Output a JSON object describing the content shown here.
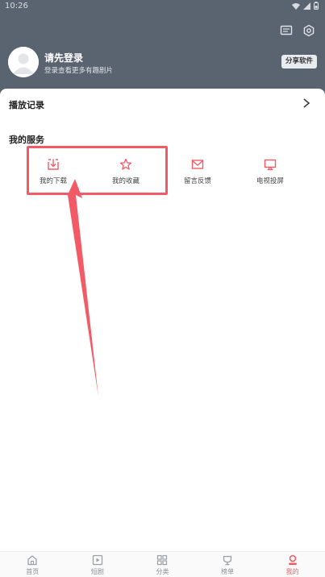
{
  "status_bar": {
    "time": "10:26"
  },
  "profile": {
    "login_title": "请先登录",
    "login_subtitle": "登录查看更多有趣剧片",
    "share_button": "分享软件"
  },
  "history": {
    "label": "播放记录"
  },
  "services": {
    "title": "我的服务",
    "items": [
      {
        "label": "我的下载",
        "icon": "download-icon"
      },
      {
        "label": "我的收藏",
        "icon": "star-icon"
      },
      {
        "label": "留言反馈",
        "icon": "mail-icon"
      },
      {
        "label": "电视投屏",
        "icon": "tv-cast-icon"
      }
    ]
  },
  "tabs": [
    {
      "label": "首页",
      "icon": "home-icon"
    },
    {
      "label": "短剧",
      "icon": "play-icon"
    },
    {
      "label": "分类",
      "icon": "grid-icon"
    },
    {
      "label": "榜单",
      "icon": "trophy-icon"
    },
    {
      "label": "我的",
      "icon": "profile-icon"
    }
  ],
  "colors": {
    "header": "#5a6470",
    "accent": "#f25a66",
    "background": "#ffffff"
  }
}
